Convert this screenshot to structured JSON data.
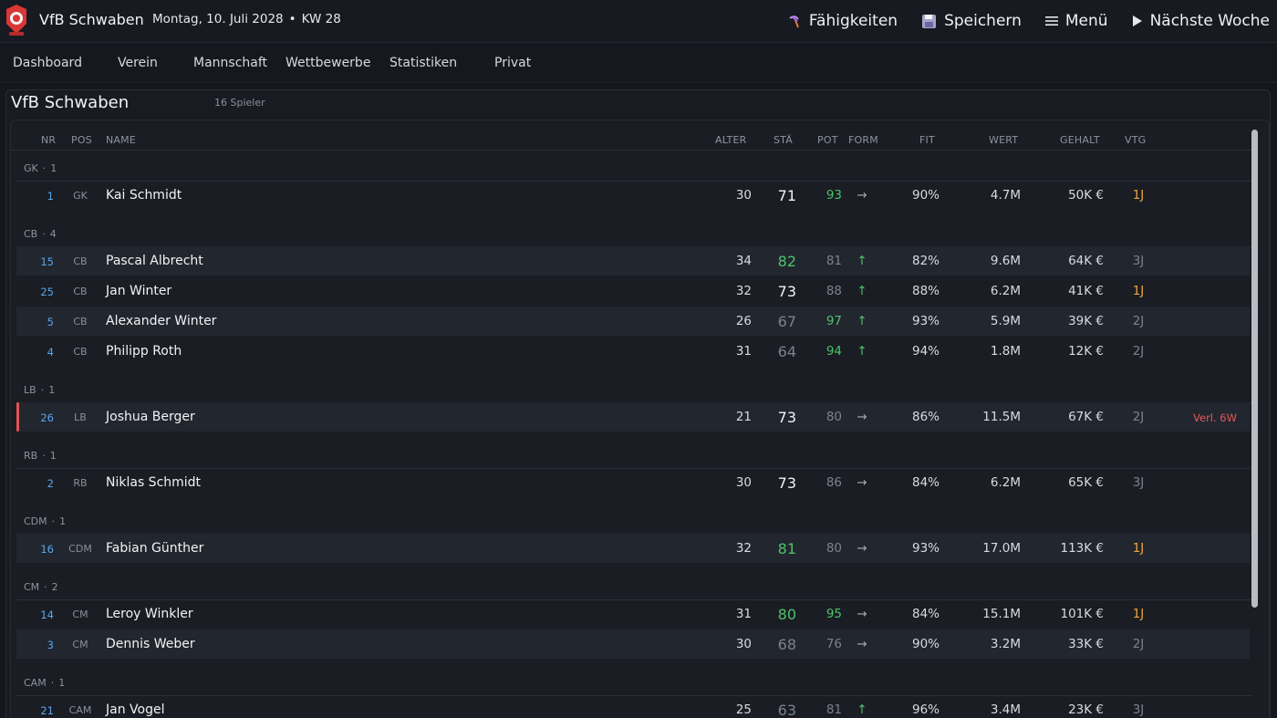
{
  "topbar": {
    "club_name": "VfB Schwaben",
    "date": "Montag, 10. Juli 2028",
    "week": "KW 28",
    "actions": [
      {
        "label": "Fähigkeiten",
        "icon": "skills-icon"
      },
      {
        "label": "Speichern",
        "icon": "save-icon"
      },
      {
        "label": "Menü",
        "icon": "menu-icon"
      },
      {
        "label": "Nächste Woche",
        "icon": "play-icon"
      }
    ]
  },
  "nav": [
    "Dashboard",
    "Verein",
    "Mannschaft",
    "Wettbewerbe",
    "Statistiken",
    "Privat"
  ],
  "panel": {
    "title": "VfB Schwaben",
    "count": "16 Spieler"
  },
  "columns": {
    "nr": "NR",
    "pos": "POS",
    "name": "NAME",
    "age": "ALTER",
    "sta": "STÄ",
    "pot": "POT",
    "form": "FORM",
    "fit": "FIT",
    "wert": "WERT",
    "gehalt": "GEHALT",
    "vtg": "VTG"
  },
  "colors": {
    "accent_blue": "#5aa5ee",
    "positive_green": "#4ec26a",
    "warning_orange": "#f0a43a",
    "alert_red": "#e05252",
    "background": "#14171d"
  },
  "groups": [
    {
      "pos": "GK",
      "count": "1",
      "players": [
        {
          "nr": "1",
          "pos": "GK",
          "name": "Kai Schmidt",
          "age": "30",
          "sta": "71",
          "sta_color": "white",
          "pot": "93",
          "pot_color": "green",
          "form": "→",
          "form_up": false,
          "fit": "90%",
          "wert": "4.7M",
          "gehalt": "50K €",
          "vtg": "1J",
          "vtg_warn": true,
          "note": "",
          "alt": false
        }
      ]
    },
    {
      "pos": "CB",
      "count": "4",
      "players": [
        {
          "nr": "15",
          "pos": "CB",
          "name": "Pascal Albrecht",
          "age": "34",
          "sta": "82",
          "sta_color": "green",
          "pot": "81",
          "pot_color": "gray",
          "form": "↑",
          "form_up": true,
          "fit": "82%",
          "wert": "9.6M",
          "gehalt": "64K €",
          "vtg": "3J",
          "vtg_warn": false,
          "note": "",
          "alt": true
        },
        {
          "nr": "25",
          "pos": "CB",
          "name": "Jan Winter",
          "age": "32",
          "sta": "73",
          "sta_color": "white",
          "pot": "88",
          "pot_color": "gray",
          "form": "↑",
          "form_up": true,
          "fit": "88%",
          "wert": "6.2M",
          "gehalt": "41K €",
          "vtg": "1J",
          "vtg_warn": true,
          "note": "",
          "alt": false
        },
        {
          "nr": "5",
          "pos": "CB",
          "name": "Alexander Winter",
          "age": "26",
          "sta": "67",
          "sta_color": "gray",
          "pot": "97",
          "pot_color": "green",
          "form": "↑",
          "form_up": true,
          "fit": "93%",
          "wert": "5.9M",
          "gehalt": "39K €",
          "vtg": "2J",
          "vtg_warn": false,
          "note": "",
          "alt": true
        },
        {
          "nr": "4",
          "pos": "CB",
          "name": "Philipp Roth",
          "age": "31",
          "sta": "64",
          "sta_color": "gray",
          "pot": "94",
          "pot_color": "green",
          "form": "↑",
          "form_up": true,
          "fit": "94%",
          "wert": "1.8M",
          "gehalt": "12K €",
          "vtg": "2J",
          "vtg_warn": false,
          "note": "",
          "alt": false
        }
      ]
    },
    {
      "pos": "LB",
      "count": "1",
      "players": [
        {
          "nr": "26",
          "pos": "LB",
          "name": "Joshua Berger",
          "age": "21",
          "sta": "73",
          "sta_color": "white",
          "pot": "80",
          "pot_color": "gray",
          "form": "→",
          "form_up": false,
          "fit": "86%",
          "wert": "11.5M",
          "gehalt": "67K €",
          "vtg": "2J",
          "vtg_warn": false,
          "note": "Verl. 6W",
          "alt": true,
          "alert": true
        }
      ]
    },
    {
      "pos": "RB",
      "count": "1",
      "players": [
        {
          "nr": "2",
          "pos": "RB",
          "name": "Niklas Schmidt",
          "age": "30",
          "sta": "73",
          "sta_color": "white",
          "pot": "86",
          "pot_color": "gray",
          "form": "→",
          "form_up": false,
          "fit": "84%",
          "wert": "6.2M",
          "gehalt": "65K €",
          "vtg": "3J",
          "vtg_warn": false,
          "note": "",
          "alt": false
        }
      ]
    },
    {
      "pos": "CDM",
      "count": "1",
      "players": [
        {
          "nr": "16",
          "pos": "CDM",
          "name": "Fabian Günther",
          "age": "32",
          "sta": "81",
          "sta_color": "green",
          "pot": "80",
          "pot_color": "gray",
          "form": "→",
          "form_up": false,
          "fit": "93%",
          "wert": "17.0M",
          "gehalt": "113K €",
          "vtg": "1J",
          "vtg_warn": true,
          "note": "",
          "alt": true
        }
      ]
    },
    {
      "pos": "CM",
      "count": "2",
      "players": [
        {
          "nr": "14",
          "pos": "CM",
          "name": "Leroy Winkler",
          "age": "31",
          "sta": "80",
          "sta_color": "green",
          "pot": "95",
          "pot_color": "green",
          "form": "→",
          "form_up": false,
          "fit": "84%",
          "wert": "15.1M",
          "gehalt": "101K €",
          "vtg": "1J",
          "vtg_warn": true,
          "note": "",
          "alt": false
        },
        {
          "nr": "3",
          "pos": "CM",
          "name": "Dennis Weber",
          "age": "30",
          "sta": "68",
          "sta_color": "gray",
          "pot": "76",
          "pot_color": "gray",
          "form": "→",
          "form_up": false,
          "fit": "90%",
          "wert": "3.2M",
          "gehalt": "33K €",
          "vtg": "2J",
          "vtg_warn": false,
          "note": "",
          "alt": true
        }
      ]
    },
    {
      "pos": "CAM",
      "count": "1",
      "players": [
        {
          "nr": "21",
          "pos": "CAM",
          "name": "Jan Vogel",
          "age": "25",
          "sta": "63",
          "sta_color": "gray",
          "pot": "81",
          "pot_color": "gray",
          "form": "↑",
          "form_up": true,
          "fit": "96%",
          "wert": "3.4M",
          "gehalt": "23K €",
          "vtg": "3J",
          "vtg_warn": false,
          "note": "",
          "alt": false
        }
      ]
    }
  ]
}
